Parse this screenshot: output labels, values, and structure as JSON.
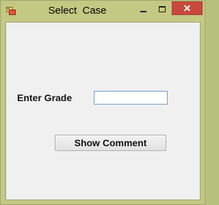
{
  "window": {
    "title": "Select  Case",
    "controls": {
      "minimize_icon": "minimize-icon",
      "maximize_icon": "maximize-icon",
      "close_icon": "close-icon",
      "close_glyph": "✕"
    },
    "colors": {
      "frame": "#c3c883",
      "client": "#f0f0f0",
      "close_button": "#c74a3d"
    }
  },
  "form": {
    "grade_label": "Enter Grade",
    "grade_value": "",
    "show_comment_label": "Show Comment"
  }
}
